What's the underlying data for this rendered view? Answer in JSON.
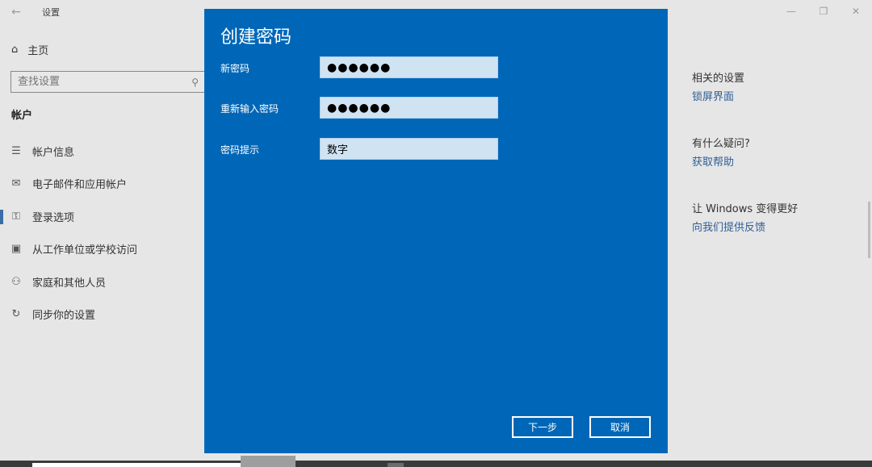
{
  "window": {
    "title": "设置",
    "back_icon": "←",
    "minimize_icon": "—",
    "restore_icon": "❐",
    "close_icon": "✕"
  },
  "sidebar": {
    "home_icon": "⌂",
    "home_label": "主页",
    "search_placeholder": "查找设置",
    "search_icon": "⚲",
    "section_title": "帐户",
    "items": [
      {
        "icon": "☰",
        "label": "帐户信息"
      },
      {
        "icon": "✉",
        "label": "电子邮件和应用帐户"
      },
      {
        "icon": "⚿",
        "label": "登录选项"
      },
      {
        "icon": "▣",
        "label": "从工作单位或学校访问"
      },
      {
        "icon": "⚇",
        "label": "家庭和其他人员"
      },
      {
        "icon": "↻",
        "label": "同步你的设置"
      }
    ]
  },
  "right_panel": {
    "related_title": "相关的设置",
    "related_link": "锁屏界面",
    "question_title": "有什么疑问?",
    "question_link": "获取帮助",
    "improve_title": "让 Windows 变得更好",
    "improve_link": "向我们提供反馈"
  },
  "dialog": {
    "title": "创建密码",
    "new_password_label": "新密码",
    "new_password_value": "●●●●●●",
    "confirm_password_label": "重新输入密码",
    "confirm_password_value": "●●●●●●",
    "hint_label": "密码提示",
    "hint_value": "数字",
    "next_button": "下一步",
    "cancel_button": "取消",
    "accent_color": "#0067b8"
  }
}
